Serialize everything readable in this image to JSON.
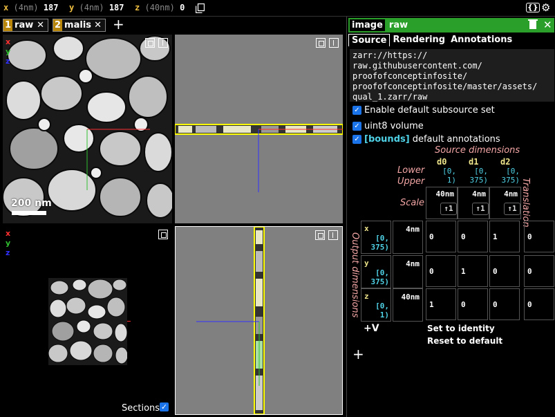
{
  "coords": {
    "x": {
      "label": "x",
      "unit": "(4nm)",
      "value": "187"
    },
    "y": {
      "label": "y",
      "unit": "(4nm)",
      "value": "187"
    },
    "z": {
      "label": "z",
      "unit": "(40nm)",
      "value": "0"
    }
  },
  "layers": [
    {
      "num": "1",
      "name": "raw",
      "close": "✕"
    },
    {
      "num": "2",
      "name": "malis",
      "close": "✕"
    }
  ],
  "add_layer_label": "+",
  "toolbar_icons": {
    "json": "{}",
    "gear": "⚙"
  },
  "panels": {
    "axis_x": "x",
    "axis_y": "y",
    "axis_z": "z",
    "scale_bar": "200 nm",
    "sections_label": "Sections",
    "sections_check": "✓"
  },
  "side": {
    "layer_name": "image",
    "layer_type": "raw",
    "close": "✕",
    "tabs": [
      "Source",
      "Rendering",
      "Annotations"
    ],
    "source_url": "zarr://https://\nraw.githubusercontent.com/\nproofofconceptinfosite/\nproofofconceptinfosite/master/assets/\nqual_1.zarr/raw",
    "checks": {
      "subsource": "Enable default subsource set",
      "volume": "uint8 volume",
      "bounds_tag": "[bounds]",
      "annotations": "default annotations",
      "mark": "✓"
    },
    "transform": {
      "source_dims_title": "Source dimensions",
      "dims": [
        "d0",
        "d1",
        "d2"
      ],
      "lower_label": "Lower",
      "upper_label": "Upper",
      "scale_label": "Scale",
      "translation_label": "Translation",
      "output_label": "Output dimensions",
      "bounds": [
        "[0,\n1)",
        "[0,\n375)",
        "[0,\n375)"
      ],
      "scales": [
        "40nm",
        "4nm",
        "4nm"
      ],
      "scale_btn": "↑1",
      "outputs": [
        {
          "name": "x",
          "bounds": "[0,\n375)",
          "scale": "4nm",
          "matrix": [
            "0",
            "0",
            "1"
          ],
          "translation": "0"
        },
        {
          "name": "y",
          "bounds": "[0,\n375)",
          "scale": "4nm",
          "matrix": [
            "0",
            "1",
            "0"
          ],
          "translation": "0"
        },
        {
          "name": "z",
          "bounds": "[0,\n1)",
          "scale": "40nm",
          "matrix": [
            "1",
            "0",
            "0"
          ],
          "translation": "0"
        }
      ],
      "add_dim": "+V",
      "set_identity": "Set to identity",
      "reset_default": "Reset to default"
    },
    "add_source": "+"
  },
  "colors": {
    "accent_green": "#2aa02a",
    "checkbox_blue": "#1a73e8",
    "bounds_cyan": "#4fd1e6",
    "dim_yellow": "#f0e68c",
    "label_pink": "#f4a6a6",
    "layer_num_gold": "#b8860b",
    "axis_red": "#ff3030",
    "axis_green": "#30c030",
    "axis_blue": "#3030ff",
    "slice_yellow": "#ffff00"
  }
}
